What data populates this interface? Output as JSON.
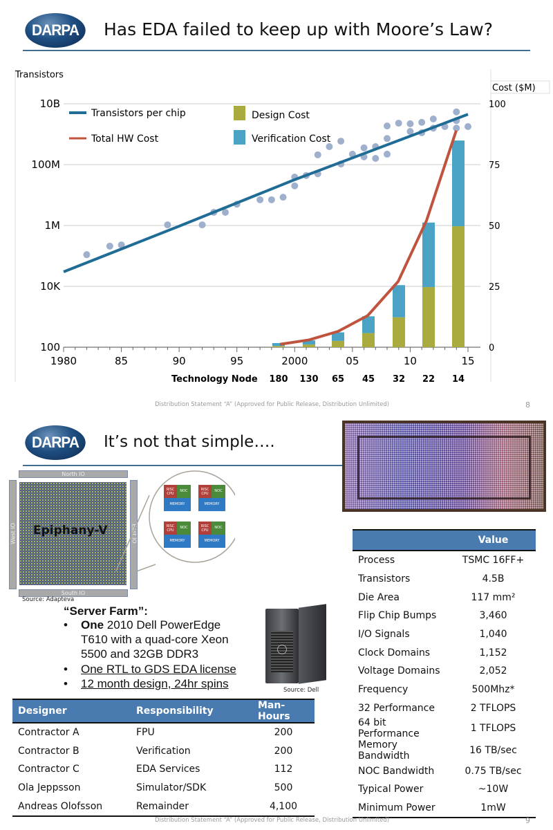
{
  "slide1": {
    "logo": "DARPA",
    "title": "Has EDA failed to keep up with Moore’s Law?",
    "footer": "Distribution Statement “A” (Approved for Public Release, Distribution Unlimited)",
    "page_number": "8"
  },
  "chart_data": {
    "type": "bar+line+scatter",
    "ylabel_left": "Transistors",
    "ylabel_right": "Cost ($M)",
    "left_axis": {
      "scale": "log",
      "range": [
        100,
        10000000000
      ],
      "ticks": [
        "100",
        "10K",
        "1M",
        "100M",
        "10B"
      ]
    },
    "right_axis": {
      "range": [
        0,
        100
      ],
      "ticks": [
        "0",
        "25",
        "50",
        "75",
        "100"
      ]
    },
    "x_axis": {
      "range": [
        1980,
        2015
      ],
      "ticks": [
        "1980",
        "85",
        "90",
        "95",
        "2000",
        "05",
        "10",
        "15"
      ]
    },
    "secondary_x_label": "Technology Node",
    "categories": [
      "180",
      "130",
      "65",
      "45",
      "32",
      "22",
      "14"
    ],
    "grid": true,
    "legend": [
      "Transistors per chip",
      "Total HW Cost",
      "Design Cost",
      "Verification Cost"
    ],
    "colors": {
      "transistors": "#1f6c96",
      "hw_cost": "#c0533e",
      "design": "#a9ab3e",
      "verification": "#4aa3c4",
      "dots": "#9fb0cc"
    },
    "series": [
      {
        "name": "Design Cost",
        "type": "bar",
        "values": [
          0.5,
          1.1,
          2.6,
          5.8,
          12.3,
          24.7,
          49.7
        ]
      },
      {
        "name": "Verification Cost",
        "type": "bar",
        "stacked": true,
        "values": [
          1.2,
          1.7,
          3.5,
          6.9,
          13.2,
          26.5,
          35.2
        ]
      },
      {
        "name": "Total HW Cost",
        "type": "line",
        "values": [
          1.2,
          3.0,
          6.5,
          13.0,
          27.0,
          52.0,
          89.0
        ]
      },
      {
        "name": "Transistors per chip",
        "type": "line",
        "x": [
          1980,
          1990,
          2000,
          2015
        ],
        "y": [
          30000,
          950000,
          32000000,
          4500000000
        ]
      },
      {
        "type": "scatter",
        "points": [
          [
            1982,
            110000
          ],
          [
            1984,
            210000
          ],
          [
            1985,
            230000
          ],
          [
            1989,
            1050000
          ],
          [
            1992,
            1050000
          ],
          [
            1993,
            2700000
          ],
          [
            1994,
            2700000
          ],
          [
            1995,
            5000000
          ],
          [
            1997,
            7000000
          ],
          [
            1998,
            7000000
          ],
          [
            1999,
            8500000
          ],
          [
            2000,
            20000000
          ],
          [
            2000,
            39000000
          ],
          [
            2001,
            44000000
          ],
          [
            2002,
            50000000
          ],
          [
            2002,
            210000000
          ],
          [
            2003,
            390000000
          ],
          [
            2004,
            590000000
          ],
          [
            2004,
            105000000
          ],
          [
            2005,
            220000000
          ],
          [
            2006,
            355000000
          ],
          [
            2006,
            180000000
          ],
          [
            2007,
            390000000
          ],
          [
            2007,
            160000000
          ],
          [
            2008,
            720000000
          ],
          [
            2008,
            220000000
          ],
          [
            2008,
            1860000000
          ],
          [
            2009,
            2300000000
          ],
          [
            2010,
            2200000000
          ],
          [
            2010,
            1230000000
          ],
          [
            2011,
            2450000000
          ],
          [
            2011,
            1120000000
          ],
          [
            2012,
            3160000000
          ],
          [
            2012,
            1580000000
          ],
          [
            2013,
            1780000000
          ],
          [
            2014,
            5400000000
          ],
          [
            2014,
            2800000000
          ],
          [
            2014,
            1580000000
          ],
          [
            2015,
            1780000000
          ]
        ]
      }
    ]
  },
  "slide2": {
    "logo": "DARPA",
    "title": "It’s not that simple….",
    "diagram": {
      "chip_label": "Epiphany-V",
      "north": "North IO",
      "south": "South IO",
      "west": "West IO",
      "east": "East IO",
      "tile_labels": {
        "cpu": "RISC CPU",
        "noc": "NOC",
        "memory": "MEMORY"
      },
      "source": "Source: Adapteva"
    },
    "server_farm": {
      "heading": "“Server Farm”:",
      "bullet1_bold": "One",
      "bullet1_lines": [
        " 2010 Dell PowerEdge",
        "T610 with a quad-core Xeon",
        "5500 and 32GB DDR3"
      ],
      "bullet2": "One RTL to GDS EDA license",
      "bullet3": "12 month design, 24hr spins",
      "bullet_char": "•",
      "image_source": "Source: Dell"
    },
    "designer_table": {
      "headers": [
        "Designer",
        "Responsibility",
        "Man-Hours"
      ],
      "rows": [
        [
          "Contractor A",
          "FPU",
          "200"
        ],
        [
          "Contractor B",
          "Verification",
          "200"
        ],
        [
          "Contractor C",
          "EDA Services",
          "112"
        ],
        [
          "Ola Jeppsson",
          "Simulator/SDK",
          "500"
        ],
        [
          "Andreas Olofsson",
          "Remainder",
          "4,100"
        ]
      ]
    },
    "spec_table": {
      "header": "Value",
      "rows": [
        [
          "Process",
          "TSMC 16FF+"
        ],
        [
          "Transistors",
          "4.5B"
        ],
        [
          "Die Area",
          "117 mm²"
        ],
        [
          "Flip Chip Bumps",
          "3,460"
        ],
        [
          "I/O Signals",
          "1,040"
        ],
        [
          "Clock Domains",
          "1,152"
        ],
        [
          "Voltage Domains",
          "2,052"
        ],
        [
          "Frequency",
          "500Mhz*"
        ],
        [
          "32 Performance",
          "2 TFLOPS"
        ],
        [
          "64 bit Performance",
          "1 TFLOPS"
        ],
        [
          "Memory Bandwidth",
          "16 TB/sec"
        ],
        [
          "NOC Bandwidth",
          "0.75 TB/sec"
        ],
        [
          "Typical Power",
          "~10W"
        ],
        [
          "Minimum Power",
          "1mW"
        ]
      ]
    },
    "footer": "Distribution Statement “A” (Approved for Public Release, Distribution Unlimited)",
    "page_number": "9"
  }
}
